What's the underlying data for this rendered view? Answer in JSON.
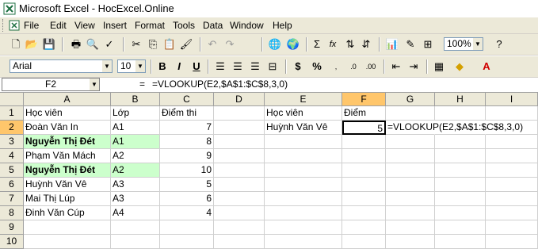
{
  "title": "Microsoft Excel - HocExcel.Online",
  "menu": [
    "File",
    "Edit",
    "View",
    "Insert",
    "Format",
    "Tools",
    "Data",
    "Window",
    "Help"
  ],
  "toolbar": {
    "zoom": "100%",
    "font_name": "Arial",
    "font_size": "10",
    "bold": "B",
    "italic": "I",
    "underline": "U",
    "sum": "Σ",
    "fx": "fx",
    "currency": "$",
    "percent": "%"
  },
  "formula_bar": {
    "name_box": "F2",
    "equals": "=",
    "formula": "=VLOOKUP(E2,$A$1:$C$8,3,0)"
  },
  "columns": [
    "A",
    "B",
    "C",
    "D",
    "E",
    "F",
    "G",
    "H",
    "I"
  ],
  "rows": [
    "1",
    "2",
    "3",
    "4",
    "5",
    "6",
    "7",
    "8",
    "9",
    "10"
  ],
  "cells": {
    "A1": "Học viên",
    "B1": "Lớp",
    "C1": "Điểm thi",
    "E1": "Học viên",
    "F1": "Điểm",
    "A2": "Đoàn Văn In",
    "B2": "A1",
    "C2": "7",
    "E2": "Huỳnh Văn Vê",
    "F2": "5",
    "G2": "=VLOOKUP(E2,$A$1:$C$8,3,0)",
    "A3": "Nguyễn Thị Đét",
    "B3": "A1",
    "C3": "8",
    "A4": "Phạm Văn Mách",
    "B4": "A2",
    "C4": "9",
    "A5": "Nguyễn Thị Đét",
    "B5": "A2",
    "C5": "10",
    "A6": "Huỳnh Văn Vê",
    "B6": "A3",
    "C6": "5",
    "A7": "Mai Thị Lúp",
    "B7": "A3",
    "C7": "6",
    "A8": "Đinh Văn Cúp",
    "B8": "A4",
    "C8": "4"
  },
  "colors": {
    "highlight_fill": "#ccffcc",
    "active_header": "#ffc66b",
    "chrome": "#ece9d8"
  }
}
